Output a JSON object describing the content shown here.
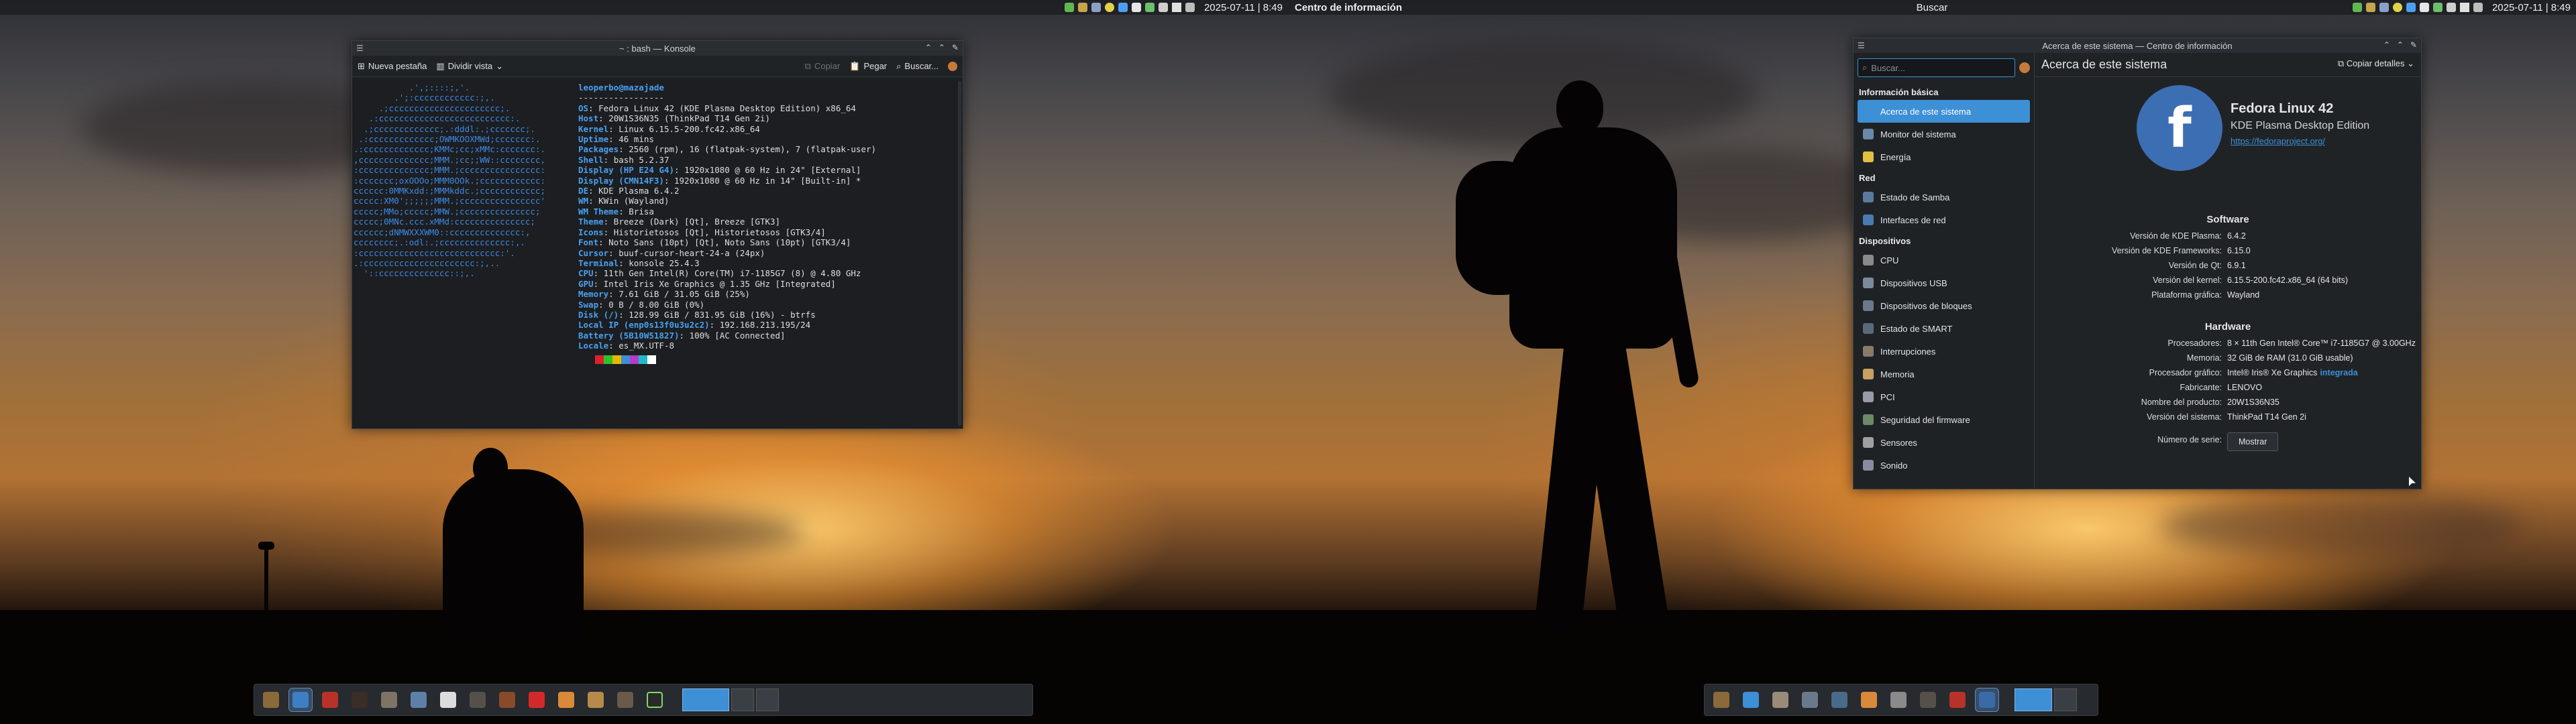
{
  "left_screen": {
    "topbar": {
      "clock": "2025-07-11 | 8:49"
    },
    "konsole": {
      "title": "~ : bash — Konsole",
      "toolbar": {
        "new_tab": "Nueva pestaña",
        "split_view": "Dividir vista",
        "copy": "Copiar",
        "paste": "Pegar",
        "search": "Buscar..."
      },
      "logo": [
        "           .',;::::;,'.",
        "        .';:cccccccccccc:;,.",
        "     .;cccccccccccccccccccccc;.",
        "   .:cccccccccccccccccccccccccc:.",
        "  .;ccccccccccccc;.:dddl:.;ccccccc;.",
        " .:ccccccccccccc;OWMKOOXMWd;ccccccc:.",
        ".:ccccccccccccc;KMMc;cc;xMMc:ccccccc:.",
        ",cccccccccccccc;MMM.;cc;;WW::cccccccc,",
        ":cccccccccccccc;MMM.;cccccccccccccccc:",
        ":ccccccc;oxOOOo;MMM0OOk.;cccccccccccc:",
        "cccccc:0MMKxdd:;MMMkddc.;cccccccccccc;",
        "ccccc:XM0';;;;;;MMM.;cccccccccccccccc'",
        "ccccc;MMo;ccccc;MMW.;ccccccccccccccc;",
        "ccccc;0MNc.ccc.xMMd:ccccccccccccccc;",
        "cccccc;dNMWXXXWM0::cccccccccccccc:,",
        "cccccccc;.:odl:.;cccccccccccccc:,.",
        ":cccccccccccccccccccccccccccc:'.",
        ".:cccccccccccccccccccccc:;,..",
        "  '::cccccccccccccc::;,."
      ],
      "user_host": "leoperbo@mazajade",
      "separator": "-----------------",
      "info": [
        {
          "k": "OS",
          "v": "Fedora Linux 42 (KDE Plasma Desktop Edition) x86_64"
        },
        {
          "k": "Host",
          "v": "20W1S36N35 (ThinkPad T14 Gen 2i)"
        },
        {
          "k": "Kernel",
          "v": "Linux 6.15.5-200.fc42.x86_64"
        },
        {
          "k": "Uptime",
          "v": "46 mins"
        },
        {
          "k": "Packages",
          "v": "2560 (rpm), 16 (flatpak-system), 7 (flatpak-user)"
        },
        {
          "k": "Shell",
          "v": "bash 5.2.37"
        },
        {
          "k": "Display (HP E24 G4)",
          "v": "1920x1080 @ 60 Hz in 24\" [External]"
        },
        {
          "k": "Display (CMN14F3)",
          "v": "1920x1080 @ 60 Hz in 14\" [Built-in] *"
        },
        {
          "k": "DE",
          "v": "KDE Plasma 6.4.2"
        },
        {
          "k": "WM",
          "v": "KWin (Wayland)"
        },
        {
          "k": "WM Theme",
          "v": "Brisa"
        },
        {
          "k": "Theme",
          "v": "Breeze (Dark) [Qt], Breeze [GTK3]"
        },
        {
          "k": "Icons",
          "v": "Historietosos [Qt], Historietosos [GTK3/4]"
        },
        {
          "k": "Font",
          "v": "Noto Sans (10pt) [Qt], Noto Sans (10pt) [GTK3/4]"
        },
        {
          "k": "Cursor",
          "v": "buuf-cursor-heart-24-a (24px)"
        },
        {
          "k": "Terminal",
          "v": "konsole 25.4.3"
        },
        {
          "k": "CPU",
          "v": "11th Gen Intel(R) Core(TM) i7-1185G7 (8) @ 4.80 GHz"
        },
        {
          "k": "GPU",
          "v": "Intel Iris Xe Graphics @ 1.35 GHz [Integrated]"
        },
        {
          "k": "Memory",
          "v": "7.61 GiB / 31.05 GiB (25%)"
        },
        {
          "k": "Swap",
          "v": "0 B / 8.00 GiB (0%)"
        },
        {
          "k": "Disk (/)",
          "v": "128.99 GiB / 831.95 GiB (16%) - btrfs"
        },
        {
          "k": "Local IP (enp0s13f0u3u2c2)",
          "v": "192.168.213.195/24"
        },
        {
          "k": "Battery (5B10W51827)",
          "v": "100% [AC Connected]"
        },
        {
          "k": "Locale",
          "v": "es_MX.UTF-8"
        }
      ],
      "swatches": [
        "#1c1e21",
        "#e0202c",
        "#2cc32c",
        "#e6b800",
        "#3d8fd6",
        "#b43cc8",
        "#22b8c8",
        "#ffffff"
      ]
    },
    "panel_icons": [
      "toolbox",
      "blue-bird",
      "red-creature",
      "dark-box",
      "cabinet",
      "notepad",
      "document",
      "chest",
      "pencil",
      "ladybug",
      "palette",
      "box-bag",
      "gear-box",
      "terminal"
    ]
  },
  "right_screen": {
    "topbar": {
      "app": "Centro de información",
      "center": "Buscar",
      "clock": "2025-07-11 | 8:49"
    },
    "infocenter": {
      "title": "Acerca de este sistema — Centro de información",
      "search_placeholder": "Buscar...",
      "page_title": "Acerca de este sistema",
      "copy_details": "Copiar detalles",
      "sidebar": [
        {
          "cat": "Información básica",
          "items": [
            "Acerca de este sistema",
            "Monitor del sistema",
            "Energía"
          ]
        },
        {
          "cat": "Red",
          "items": [
            "Estado de Samba",
            "Interfaces de red"
          ]
        },
        {
          "cat": "Dispositivos",
          "items": [
            "CPU",
            "Dispositivos USB",
            "Dispositivos de bloques",
            "Estado de SMART",
            "Interrupciones",
            "Memoria",
            "PCI",
            "Seguridad del firmware",
            "Sensores",
            "Sonido"
          ]
        }
      ],
      "distro": {
        "name": "Fedora Linux 42",
        "edition": "KDE Plasma Desktop Edition",
        "url": "https://fedoraproject.org/"
      },
      "software_title": "Software",
      "software": [
        {
          "k": "Versión de KDE Plasma:",
          "v": "6.4.2"
        },
        {
          "k": "Versión de KDE Frameworks:",
          "v": "6.15.0"
        },
        {
          "k": "Versión de Qt:",
          "v": "6.9.1"
        },
        {
          "k": "Versión del kernel:",
          "v": "6.15.5-200.fc42.x86_64 (64 bits)"
        },
        {
          "k": "Plataforma gráfica:",
          "v": "Wayland"
        }
      ],
      "hardware_title": "Hardware",
      "hardware": [
        {
          "k": "Procesadores:",
          "v": "8 × 11th Gen Intel® Core™ i7-1185G7 @ 3.00GHz"
        },
        {
          "k": "Memoria:",
          "v": "32 GiB de RAM (31.0 GiB usable)"
        },
        {
          "k": "Procesador gráfico:",
          "v": "Intel® Iris® Xe Graphics",
          "tag": "integrada"
        },
        {
          "k": "Fabricante:",
          "v": "LENOVO"
        },
        {
          "k": "Nombre del producto:",
          "v": "20W1S36N35"
        },
        {
          "k": "Versión del sistema:",
          "v": "ThinkPad T14 Gen 2i"
        }
      ],
      "serial_label": "Número de serie:",
      "serial_button": "Mostrar"
    },
    "panel_icons": [
      "toolbox",
      "globe",
      "files",
      "gear-wheel",
      "network-box",
      "palette",
      "system-monitor",
      "chest",
      "red-creature",
      "terminal-active"
    ]
  }
}
